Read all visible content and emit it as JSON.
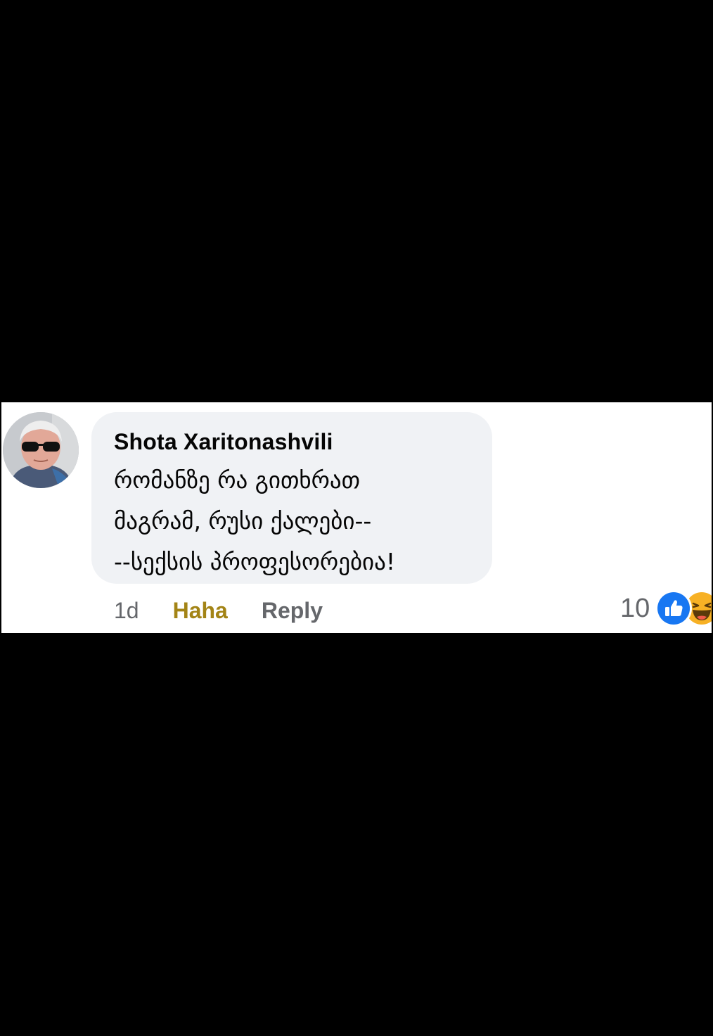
{
  "comment": {
    "author": "Shota Xaritonashvili",
    "text": "რომანზე რა გითხრათ\nმაგრამ, რუსი ქალები--\n--სექსის პროფესორებია!",
    "time": "1d",
    "haha_label": "Haha",
    "reply_label": "Reply",
    "reaction_count": "10",
    "reaction_icons": [
      "like-icon",
      "haha-icon"
    ],
    "colors": {
      "haha_active": "#a38416",
      "secondary_text": "#65676b",
      "bubble": "#f0f2f5",
      "like_blue": "#1877f2",
      "haha_yellow": "#f7b125"
    }
  }
}
